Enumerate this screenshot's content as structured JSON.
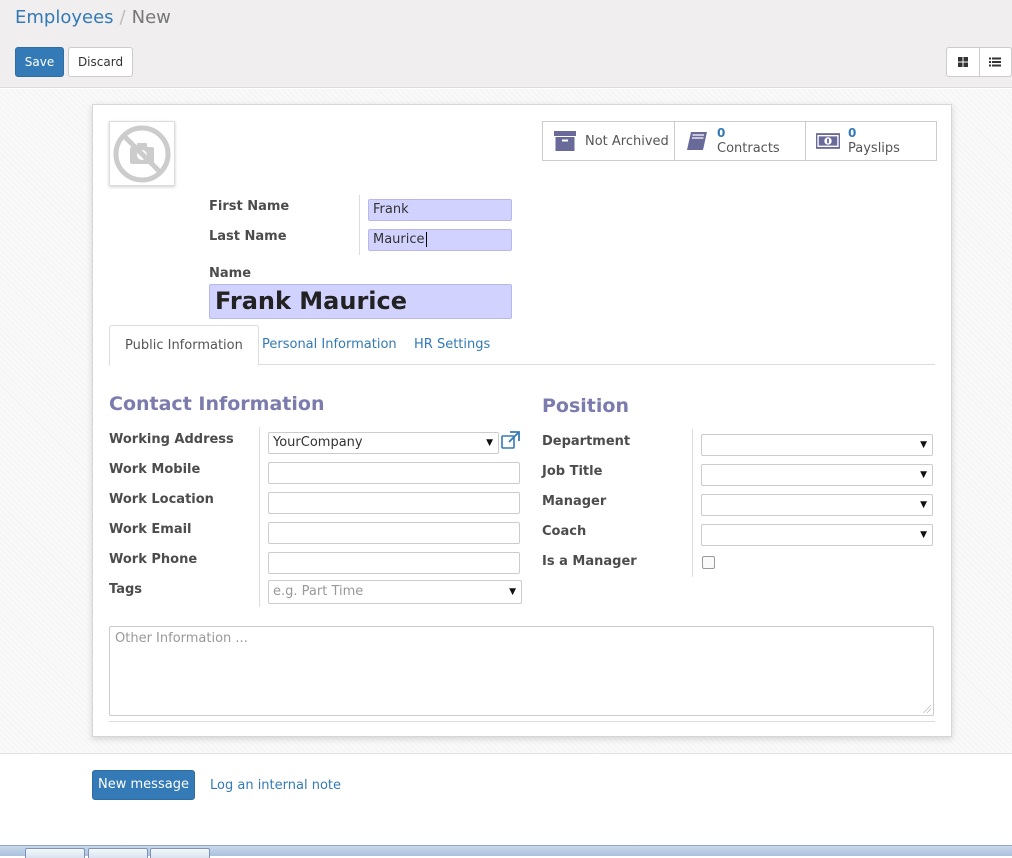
{
  "breadcrumb": {
    "parent": "Employees",
    "separator": "/",
    "current": "New"
  },
  "toolbar": {
    "save_label": "Save",
    "discard_label": "Discard"
  },
  "view_switcher": {
    "icons": [
      "kanban-icon",
      "list-icon"
    ]
  },
  "stats": {
    "archive": {
      "label": "Not Archived",
      "icon": "archive-box-icon"
    },
    "contracts": {
      "count": "0",
      "label": "Contracts",
      "icon": "book-icon"
    },
    "payslips": {
      "count": "0",
      "label": "Payslips",
      "icon": "money-icon"
    }
  },
  "names": {
    "first_name_label": "First Name",
    "first_name_value": "Frank",
    "last_name_label": "Last Name",
    "last_name_value": "Maurice",
    "name_label": "Name",
    "name_value": "Frank Maurice"
  },
  "tabs": [
    {
      "label": "Public Information",
      "active": true
    },
    {
      "label": "Personal Information",
      "active": false
    },
    {
      "label": "HR Settings",
      "active": false
    }
  ],
  "contact": {
    "title": "Contact Information",
    "working_address_label": "Working Address",
    "working_address_value": "YourCompany",
    "work_mobile_label": "Work Mobile",
    "work_location_label": "Work Location",
    "work_email_label": "Work Email",
    "work_phone_label": "Work Phone",
    "tags_label": "Tags",
    "tags_placeholder": "e.g. Part Time"
  },
  "position": {
    "title": "Position",
    "department_label": "Department",
    "job_title_label": "Job Title",
    "manager_label": "Manager",
    "coach_label": "Coach",
    "is_manager_label": "Is a Manager"
  },
  "other_info": {
    "placeholder": "Other Information ..."
  },
  "chatter": {
    "new_message_label": "New message",
    "log_note_label": "Log an internal note"
  },
  "colors": {
    "primary": "#337ab7",
    "required_field": "#d2d2ff",
    "section_title": "#7c7bad"
  }
}
